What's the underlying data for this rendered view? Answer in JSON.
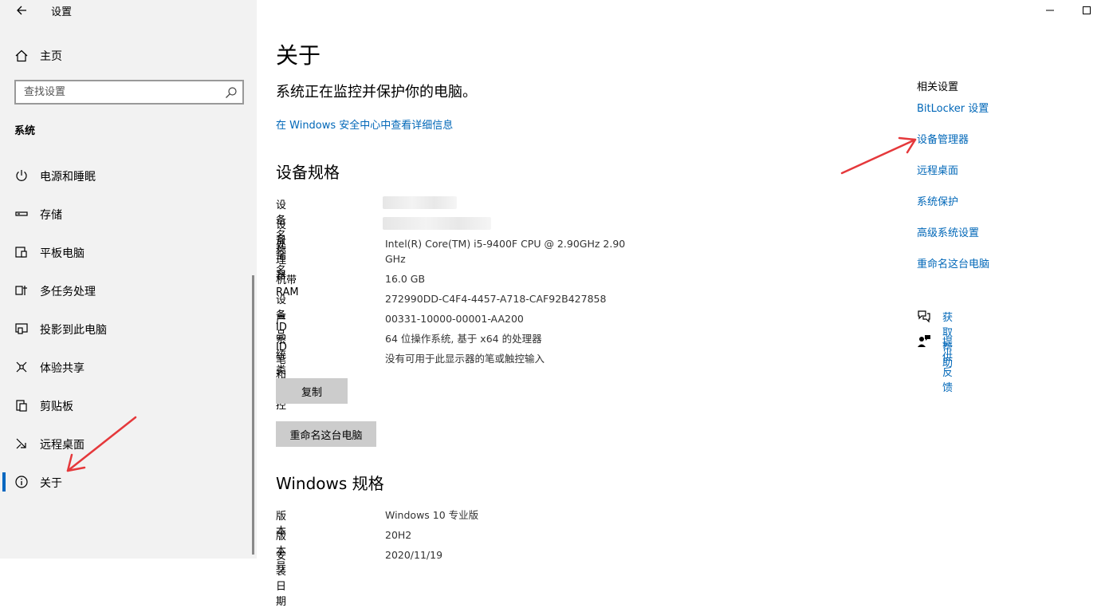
{
  "window": {
    "title": "设置"
  },
  "sidebar": {
    "home_label": "主页",
    "search_placeholder": "查找设置",
    "section_label": "系统",
    "items": [
      {
        "label": "电源和睡眠",
        "icon": "power-icon"
      },
      {
        "label": "存储",
        "icon": "storage-icon"
      },
      {
        "label": "平板电脑",
        "icon": "tablet-icon"
      },
      {
        "label": "多任务处理",
        "icon": "multitasking-icon"
      },
      {
        "label": "投影到此电脑",
        "icon": "project-icon"
      },
      {
        "label": "体验共享",
        "icon": "shared-experiences-icon"
      },
      {
        "label": "剪贴板",
        "icon": "clipboard-icon"
      },
      {
        "label": "远程桌面",
        "icon": "remote-desktop-icon"
      },
      {
        "label": "关于",
        "icon": "info-icon",
        "selected": true
      }
    ]
  },
  "main": {
    "title": "关于",
    "status": "系统正在监控并保护你的电脑。",
    "security_link": "在 Windows 安全中心中查看详细信息",
    "device_specs_title": "设备规格",
    "specs": [
      {
        "label": "设备名称",
        "value": ""
      },
      {
        "label": "设备全名",
        "value": ""
      },
      {
        "label": "处理器",
        "value": "Intel(R) Core(TM) i5-9400F CPU @ 2.90GHz   2.90 GHz"
      },
      {
        "label": "机带 RAM",
        "value": "16.0 GB"
      },
      {
        "label": "设备 ID",
        "value": "272990DD-C4F4-4457-A718-CAF92B427858"
      },
      {
        "label": "产品 ID",
        "value": "00331-10000-00001-AA200"
      },
      {
        "label": "系统类型",
        "value": "64 位操作系统, 基于 x64 的处理器"
      },
      {
        "label": "笔和触控",
        "value": "没有可用于此显示器的笔或触控输入"
      }
    ],
    "copy_button": "复制",
    "rename_button": "重命名这台电脑",
    "windows_specs_title": "Windows 规格",
    "win_specs": [
      {
        "label": "版本",
        "value": "Windows 10 专业版"
      },
      {
        "label": "版本号",
        "value": "20H2"
      },
      {
        "label": "安装日期",
        "value": "2020/11/19"
      }
    ]
  },
  "related": {
    "title": "相关设置",
    "links": [
      "BitLocker 设置",
      "设备管理器",
      "远程桌面",
      "系统保护",
      "高级系统设置",
      "重命名这台电脑"
    ],
    "help": [
      {
        "label": "获取帮助",
        "icon": "help-chat-icon"
      },
      {
        "label": "提供反馈",
        "icon": "feedback-icon"
      }
    ]
  },
  "colors": {
    "accent": "#0067c0",
    "link": "#0067b8",
    "sidebar_bg": "#f2f2f2",
    "annotation_arrow": "#e5383b"
  }
}
